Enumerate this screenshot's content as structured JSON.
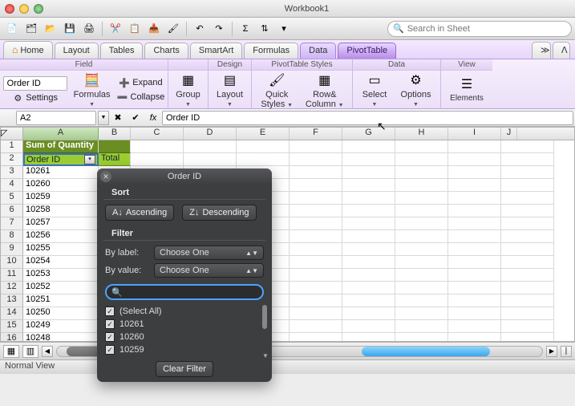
{
  "window": {
    "title": "Workbook1"
  },
  "search": {
    "placeholder": "Search in Sheet"
  },
  "tabs": {
    "home": "Home",
    "layout": "Layout",
    "tables": "Tables",
    "charts": "Charts",
    "smartart": "SmartArt",
    "formulas": "Formulas",
    "data": "Data",
    "pivot": "PivotTable"
  },
  "ribbon": {
    "field": {
      "title": "Field",
      "name_value": "Order ID",
      "expand": "Expand",
      "collapse": "Collapse",
      "settings": "Settings",
      "formulas": "Formulas"
    },
    "group": {
      "title": "",
      "group": "Group"
    },
    "design": {
      "title": "Design",
      "layout": "Layout"
    },
    "styles": {
      "title": "PivotTable Styles",
      "quick": "Quick\nStyles",
      "rc": "Row&\nColumn"
    },
    "data": {
      "title": "Data",
      "select": "Select",
      "options": "Options"
    },
    "view": {
      "title": "View",
      "elements": "Elements"
    }
  },
  "formula_bar": {
    "cell_ref": "A2",
    "fx": "fx",
    "content": "Order ID"
  },
  "columns": [
    "A",
    "B",
    "C",
    "D",
    "E",
    "F",
    "G",
    "H",
    "I",
    "J"
  ],
  "rows": [
    "1",
    "2",
    "3",
    "4",
    "5",
    "6",
    "7",
    "8",
    "9",
    "10",
    "11",
    "12",
    "13",
    "14",
    "15",
    "16"
  ],
  "grid": {
    "a1": "Sum of Quantity",
    "a2": "Order ID",
    "b2": "Total",
    "data": [
      {
        "id": "10261",
        "tot": ""
      },
      {
        "id": "10260",
        "tot": ""
      },
      {
        "id": "10259",
        "tot": ""
      },
      {
        "id": "10258",
        "tot": ""
      },
      {
        "id": "10257",
        "tot": ""
      },
      {
        "id": "10256",
        "tot": ""
      },
      {
        "id": "10255",
        "tot": ""
      },
      {
        "id": "10254",
        "tot": ""
      },
      {
        "id": "10253",
        "tot": ""
      },
      {
        "id": "10252",
        "tot": ""
      },
      {
        "id": "10251",
        "tot": ""
      },
      {
        "id": "10250",
        "tot": ""
      },
      {
        "id": "10249",
        "tot": ""
      },
      {
        "id": "10248",
        "tot": ""
      }
    ]
  },
  "popup": {
    "title": "Order ID",
    "sort": "Sort",
    "asc": "Ascending",
    "desc": "Descending",
    "filter": "Filter",
    "bylabel": "By label:",
    "byvalue": "By value:",
    "choose": "Choose One",
    "items": [
      {
        "label": "(Select All)",
        "checked": true
      },
      {
        "label": "10261",
        "checked": true
      },
      {
        "label": "10260",
        "checked": true
      },
      {
        "label": "10259",
        "checked": true
      }
    ],
    "clear": "Clear Filter"
  },
  "status": {
    "view": "Normal View"
  }
}
